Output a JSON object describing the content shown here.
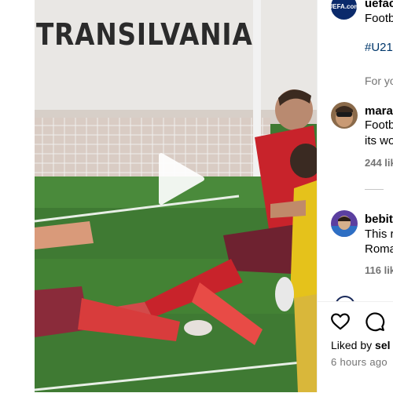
{
  "video": {
    "banner_text": "TRANSILVANIA",
    "play_icon": "play-icon"
  },
  "post": {
    "author": "uefac",
    "avatar_text": "UEFA.com",
    "caption": "Footb",
    "hashtag": "#U21",
    "translation_hint": "For yo"
  },
  "comments": [
    {
      "username": "mara",
      "text_line1": "Footb",
      "text_line2": "its wo",
      "likes": "244 lik"
    },
    {
      "username": "bebit",
      "text_line1": "This r",
      "text_line2": "Roma",
      "likes": "116 lik"
    }
  ],
  "actions": {
    "like_icon": "heart-icon",
    "comment_icon": "comment-icon",
    "liked_by_prefix": "Liked by ",
    "liked_by_user": "sel",
    "timestamp": "6 hours ago"
  },
  "colors": {
    "pitch": "#3f7a33",
    "shirt_red": "#c8232b",
    "shirt_yellow": "#e5c21b",
    "hashtag": "#00376b",
    "muted": "#737373"
  }
}
